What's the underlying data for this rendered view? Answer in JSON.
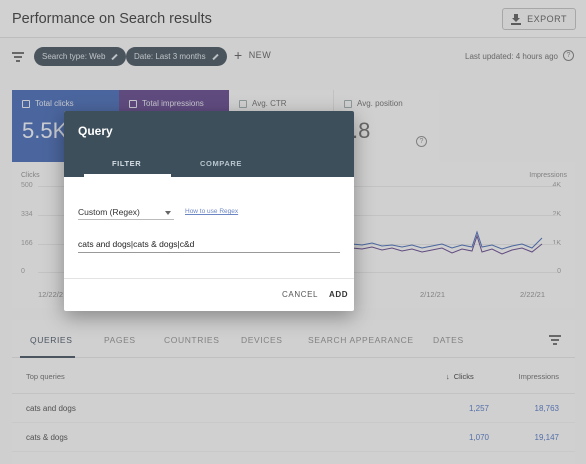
{
  "header": {
    "title": "Performance on Search results",
    "export_label": "EXPORT"
  },
  "filter_bar": {
    "chips": [
      {
        "label": "Search type: Web"
      },
      {
        "label": "Date: Last 3 months"
      }
    ],
    "new_label": "NEW",
    "last_updated": "Last updated: 4 hours ago"
  },
  "metrics": {
    "clicks": {
      "label": "Total clicks",
      "value": "5.5K"
    },
    "impressions": {
      "label": "Total impressions",
      "value": ""
    },
    "ctr": {
      "label": "Avg. CTR",
      "value": ""
    },
    "position": {
      "label": "Avg. position",
      "value": ".8"
    }
  },
  "chart": {
    "left_axis_title": "Clicks",
    "right_axis_title": "Impressions",
    "left_ticks": [
      "500",
      "334",
      "166",
      "0"
    ],
    "right_ticks": [
      "4K",
      "2K",
      "1K",
      "0"
    ],
    "x_ticks": [
      "12/22/2",
      "2/12/21",
      "2/22/21"
    ]
  },
  "chart_data": {
    "type": "line",
    "x": [
      "12/22/2",
      "2/12/21",
      "2/22/21"
    ],
    "series": [
      {
        "name": "Clicks",
        "color": "#3e63b0"
      },
      {
        "name": "Impressions",
        "color": "#5b3d86"
      }
    ],
    "left_ylim": [
      0,
      500
    ],
    "right_ylim": [
      0,
      4000
    ]
  },
  "table": {
    "tabs": [
      "QUERIES",
      "PAGES",
      "COUNTRIES",
      "DEVICES",
      "SEARCH APPEARANCE",
      "DATES"
    ],
    "active_tab": "QUERIES",
    "columns": {
      "query": "Top queries",
      "clicks": "Clicks",
      "impressions": "Impressions"
    },
    "rows": [
      {
        "query": "cats and dogs",
        "clicks": "1,257",
        "impressions": "18,763"
      },
      {
        "query": "cats & dogs",
        "clicks": "1,070",
        "impressions": "19,147"
      }
    ]
  },
  "dialog": {
    "title": "Query",
    "tabs": {
      "filter": "FILTER",
      "compare": "COMPARE"
    },
    "match_type": "Custom (Regex)",
    "help_link": "How to use Regex",
    "regex_value": "cats and dogs|cats & dogs|c&d",
    "cancel_label": "CANCEL",
    "add_label": "ADD"
  },
  "colors": {
    "dialog_header": "#3d4f5b",
    "clicks_card": "#3e63b0",
    "impressions_card": "#5b3d86",
    "link": "#4a6fc0"
  }
}
